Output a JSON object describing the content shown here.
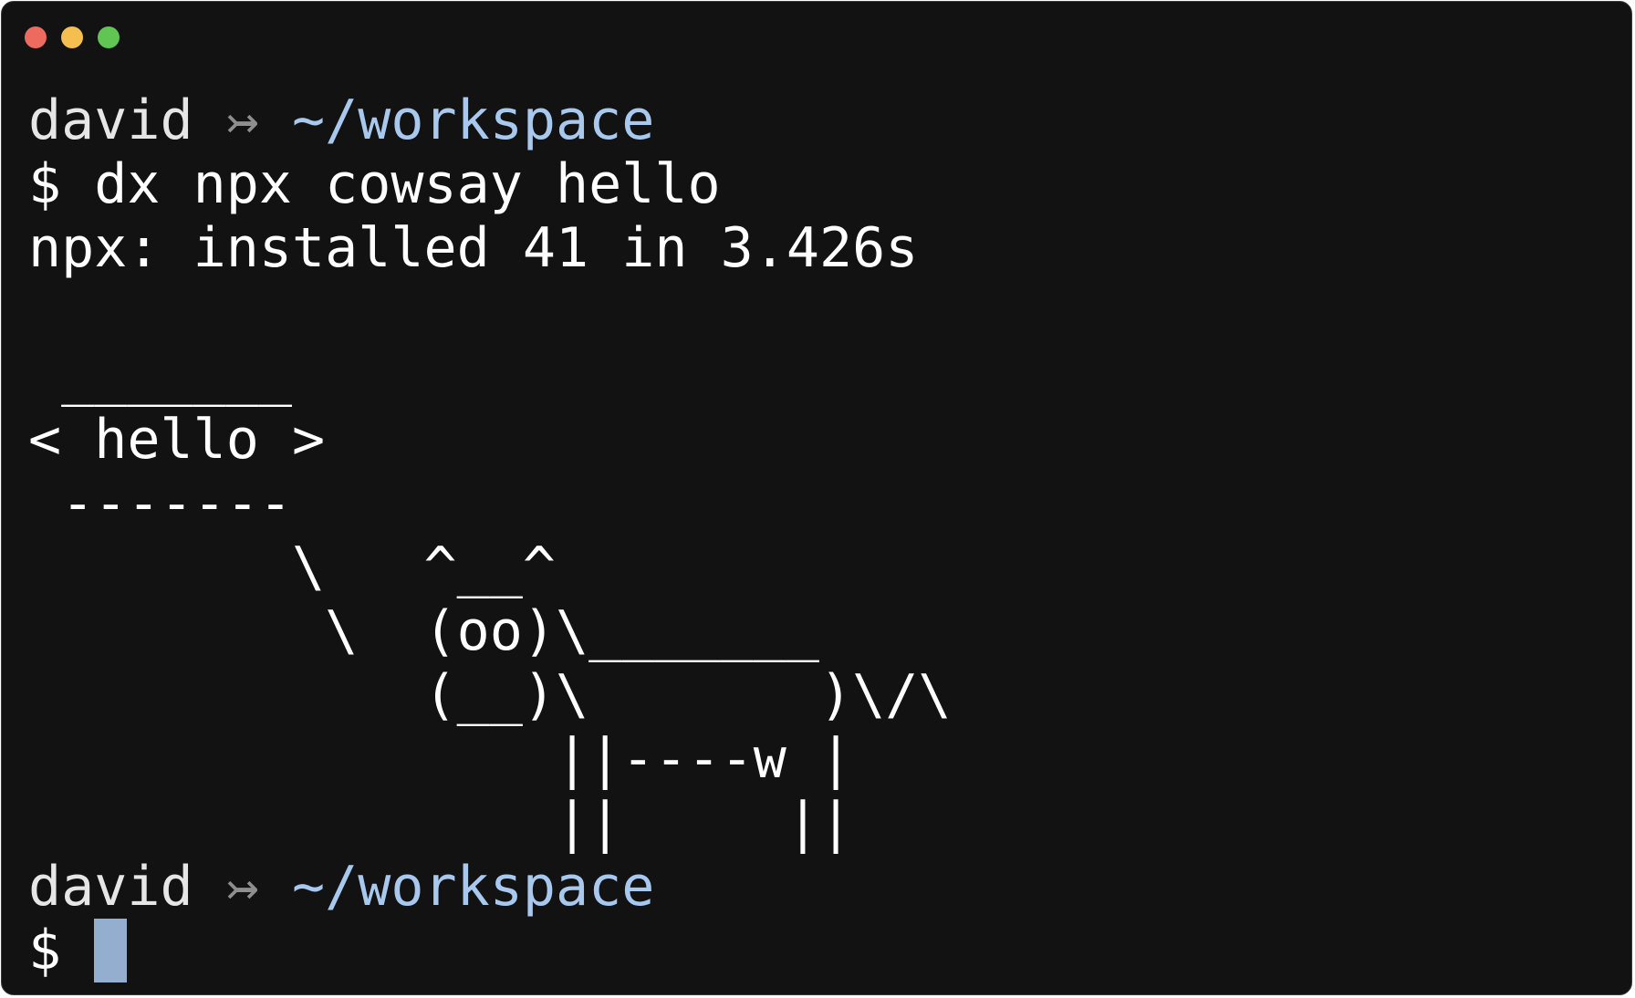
{
  "window": {
    "controls": [
      {
        "name": "close",
        "color": "#ed6a5e"
      },
      {
        "name": "minimize",
        "color": "#f5bf4f"
      },
      {
        "name": "zoom",
        "color": "#61c554"
      }
    ]
  },
  "prompt1": {
    "user": "david",
    "arrow": "↣",
    "path": "~/workspace"
  },
  "command1": {
    "symbol": "$",
    "text": "dx npx cowsay hello"
  },
  "output": [
    "npx: installed 41 in 3.426s",
    "",
    " _______",
    "< hello >",
    " -------",
    "        \\   ^__^",
    "         \\  (oo)\\_______",
    "            (__)\\       )\\/\\",
    "                ||----w |",
    "                ||     ||"
  ],
  "prompt2": {
    "user": "david",
    "arrow": "↣",
    "path": "~/workspace"
  },
  "command2": {
    "symbol": "$",
    "text": ""
  },
  "colors": {
    "background": "#121212",
    "text": "#ffffff",
    "path": "#a9c8ee",
    "arrow": "#8e8e8e",
    "cursor": "#94aed0"
  }
}
